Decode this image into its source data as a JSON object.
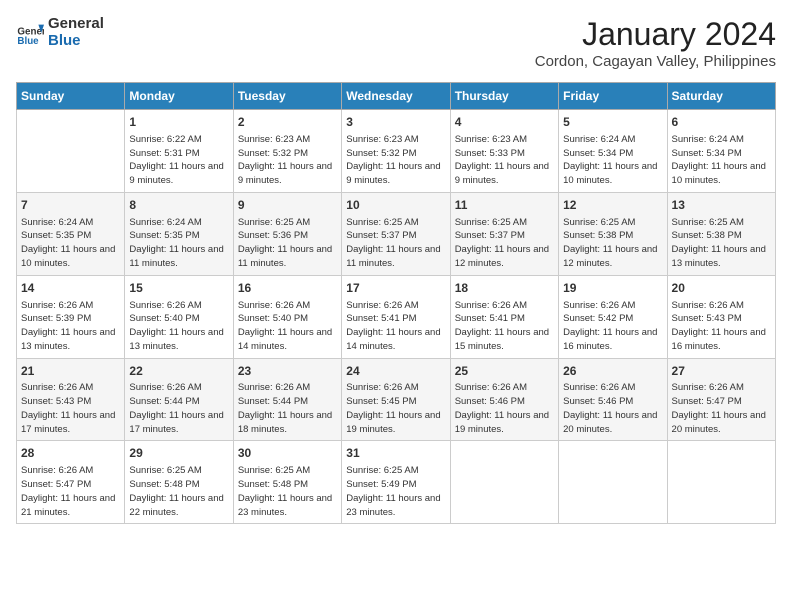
{
  "logo": {
    "line1": "General",
    "line2": "Blue"
  },
  "title": "January 2024",
  "subtitle": "Cordon, Cagayan Valley, Philippines",
  "days_of_week": [
    "Sunday",
    "Monday",
    "Tuesday",
    "Wednesday",
    "Thursday",
    "Friday",
    "Saturday"
  ],
  "weeks": [
    [
      {
        "day": "",
        "sunrise": "",
        "sunset": "",
        "daylight": ""
      },
      {
        "day": "1",
        "sunrise": "Sunrise: 6:22 AM",
        "sunset": "Sunset: 5:31 PM",
        "daylight": "Daylight: 11 hours and 9 minutes."
      },
      {
        "day": "2",
        "sunrise": "Sunrise: 6:23 AM",
        "sunset": "Sunset: 5:32 PM",
        "daylight": "Daylight: 11 hours and 9 minutes."
      },
      {
        "day": "3",
        "sunrise": "Sunrise: 6:23 AM",
        "sunset": "Sunset: 5:32 PM",
        "daylight": "Daylight: 11 hours and 9 minutes."
      },
      {
        "day": "4",
        "sunrise": "Sunrise: 6:23 AM",
        "sunset": "Sunset: 5:33 PM",
        "daylight": "Daylight: 11 hours and 9 minutes."
      },
      {
        "day": "5",
        "sunrise": "Sunrise: 6:24 AM",
        "sunset": "Sunset: 5:34 PM",
        "daylight": "Daylight: 11 hours and 10 minutes."
      },
      {
        "day": "6",
        "sunrise": "Sunrise: 6:24 AM",
        "sunset": "Sunset: 5:34 PM",
        "daylight": "Daylight: 11 hours and 10 minutes."
      }
    ],
    [
      {
        "day": "7",
        "sunrise": "Sunrise: 6:24 AM",
        "sunset": "Sunset: 5:35 PM",
        "daylight": "Daylight: 11 hours and 10 minutes."
      },
      {
        "day": "8",
        "sunrise": "Sunrise: 6:24 AM",
        "sunset": "Sunset: 5:35 PM",
        "daylight": "Daylight: 11 hours and 11 minutes."
      },
      {
        "day": "9",
        "sunrise": "Sunrise: 6:25 AM",
        "sunset": "Sunset: 5:36 PM",
        "daylight": "Daylight: 11 hours and 11 minutes."
      },
      {
        "day": "10",
        "sunrise": "Sunrise: 6:25 AM",
        "sunset": "Sunset: 5:37 PM",
        "daylight": "Daylight: 11 hours and 11 minutes."
      },
      {
        "day": "11",
        "sunrise": "Sunrise: 6:25 AM",
        "sunset": "Sunset: 5:37 PM",
        "daylight": "Daylight: 11 hours and 12 minutes."
      },
      {
        "day": "12",
        "sunrise": "Sunrise: 6:25 AM",
        "sunset": "Sunset: 5:38 PM",
        "daylight": "Daylight: 11 hours and 12 minutes."
      },
      {
        "day": "13",
        "sunrise": "Sunrise: 6:25 AM",
        "sunset": "Sunset: 5:38 PM",
        "daylight": "Daylight: 11 hours and 13 minutes."
      }
    ],
    [
      {
        "day": "14",
        "sunrise": "Sunrise: 6:26 AM",
        "sunset": "Sunset: 5:39 PM",
        "daylight": "Daylight: 11 hours and 13 minutes."
      },
      {
        "day": "15",
        "sunrise": "Sunrise: 6:26 AM",
        "sunset": "Sunset: 5:40 PM",
        "daylight": "Daylight: 11 hours and 13 minutes."
      },
      {
        "day": "16",
        "sunrise": "Sunrise: 6:26 AM",
        "sunset": "Sunset: 5:40 PM",
        "daylight": "Daylight: 11 hours and 14 minutes."
      },
      {
        "day": "17",
        "sunrise": "Sunrise: 6:26 AM",
        "sunset": "Sunset: 5:41 PM",
        "daylight": "Daylight: 11 hours and 14 minutes."
      },
      {
        "day": "18",
        "sunrise": "Sunrise: 6:26 AM",
        "sunset": "Sunset: 5:41 PM",
        "daylight": "Daylight: 11 hours and 15 minutes."
      },
      {
        "day": "19",
        "sunrise": "Sunrise: 6:26 AM",
        "sunset": "Sunset: 5:42 PM",
        "daylight": "Daylight: 11 hours and 16 minutes."
      },
      {
        "day": "20",
        "sunrise": "Sunrise: 6:26 AM",
        "sunset": "Sunset: 5:43 PM",
        "daylight": "Daylight: 11 hours and 16 minutes."
      }
    ],
    [
      {
        "day": "21",
        "sunrise": "Sunrise: 6:26 AM",
        "sunset": "Sunset: 5:43 PM",
        "daylight": "Daylight: 11 hours and 17 minutes."
      },
      {
        "day": "22",
        "sunrise": "Sunrise: 6:26 AM",
        "sunset": "Sunset: 5:44 PM",
        "daylight": "Daylight: 11 hours and 17 minutes."
      },
      {
        "day": "23",
        "sunrise": "Sunrise: 6:26 AM",
        "sunset": "Sunset: 5:44 PM",
        "daylight": "Daylight: 11 hours and 18 minutes."
      },
      {
        "day": "24",
        "sunrise": "Sunrise: 6:26 AM",
        "sunset": "Sunset: 5:45 PM",
        "daylight": "Daylight: 11 hours and 19 minutes."
      },
      {
        "day": "25",
        "sunrise": "Sunrise: 6:26 AM",
        "sunset": "Sunset: 5:46 PM",
        "daylight": "Daylight: 11 hours and 19 minutes."
      },
      {
        "day": "26",
        "sunrise": "Sunrise: 6:26 AM",
        "sunset": "Sunset: 5:46 PM",
        "daylight": "Daylight: 11 hours and 20 minutes."
      },
      {
        "day": "27",
        "sunrise": "Sunrise: 6:26 AM",
        "sunset": "Sunset: 5:47 PM",
        "daylight": "Daylight: 11 hours and 20 minutes."
      }
    ],
    [
      {
        "day": "28",
        "sunrise": "Sunrise: 6:26 AM",
        "sunset": "Sunset: 5:47 PM",
        "daylight": "Daylight: 11 hours and 21 minutes."
      },
      {
        "day": "29",
        "sunrise": "Sunrise: 6:25 AM",
        "sunset": "Sunset: 5:48 PM",
        "daylight": "Daylight: 11 hours and 22 minutes."
      },
      {
        "day": "30",
        "sunrise": "Sunrise: 6:25 AM",
        "sunset": "Sunset: 5:48 PM",
        "daylight": "Daylight: 11 hours and 23 minutes."
      },
      {
        "day": "31",
        "sunrise": "Sunrise: 6:25 AM",
        "sunset": "Sunset: 5:49 PM",
        "daylight": "Daylight: 11 hours and 23 minutes."
      },
      {
        "day": "",
        "sunrise": "",
        "sunset": "",
        "daylight": ""
      },
      {
        "day": "",
        "sunrise": "",
        "sunset": "",
        "daylight": ""
      },
      {
        "day": "",
        "sunrise": "",
        "sunset": "",
        "daylight": ""
      }
    ]
  ]
}
